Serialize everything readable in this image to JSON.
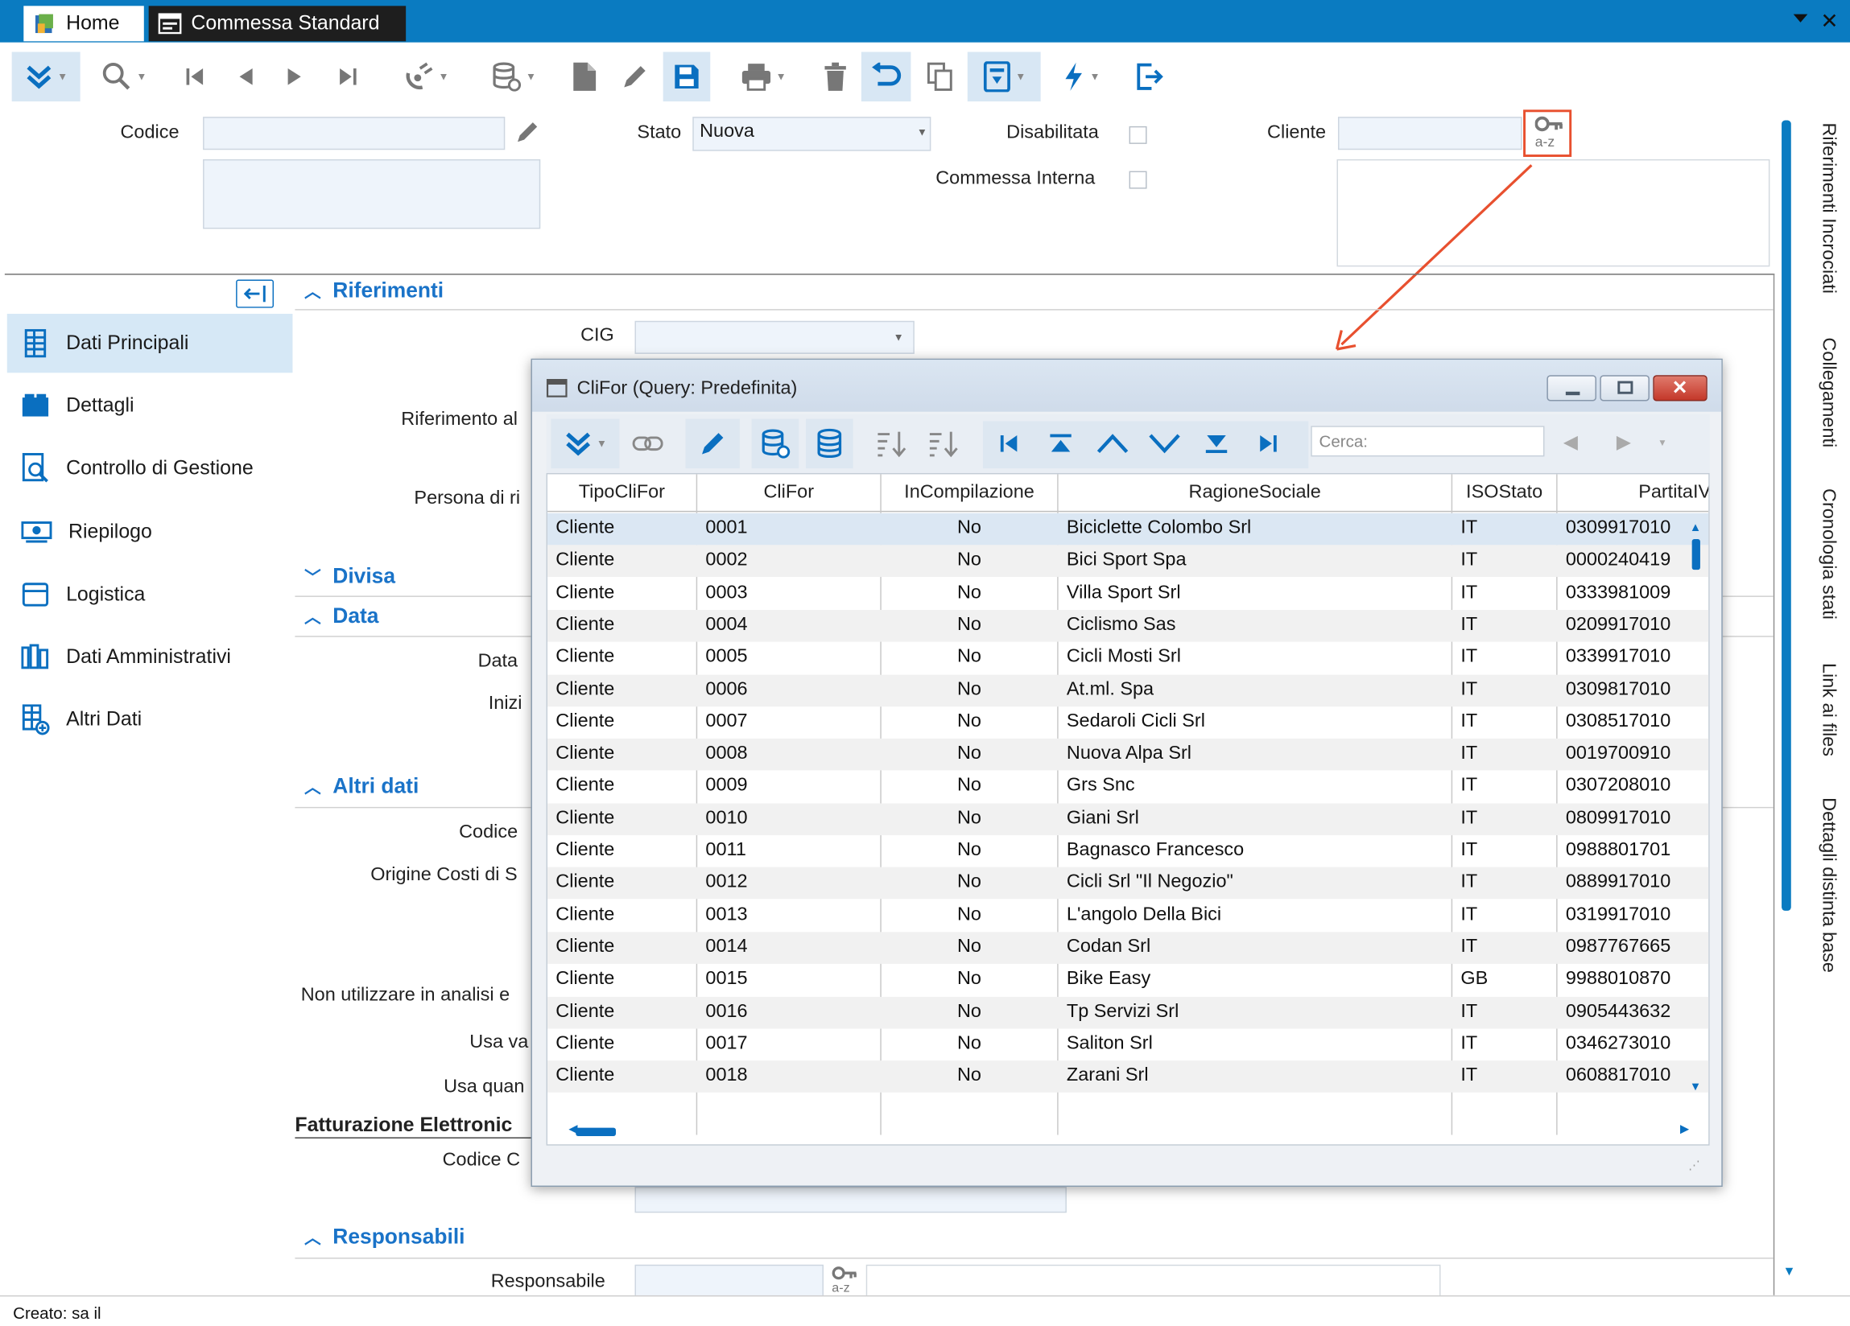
{
  "titlebar": {
    "home_label": "Home",
    "commessa_label": "Commessa Standard"
  },
  "toolbar": {
    "icons": [
      "double-chevron-down-icon",
      "search-icon",
      "first-icon",
      "prev-icon",
      "next-icon",
      "last-icon",
      "satellite-icon",
      "database-icon",
      "new-doc-icon",
      "edit-icon",
      "save-icon",
      "print-icon",
      "delete-icon",
      "undo-icon",
      "copy-icon",
      "report-icon",
      "flash-icon",
      "exit-icon"
    ]
  },
  "header": {
    "codice_label": "Codice",
    "codice_value": "",
    "stato_label": "Stato",
    "stato_value": "Nuova",
    "disabilitata_label": "Disabilitata",
    "commessa_interna_label": "Commessa Interna",
    "cliente_label": "Cliente",
    "cliente_value": "",
    "lookup_icon_text": "a-z"
  },
  "sidebar": {
    "items": [
      {
        "label": "Dati Principali"
      },
      {
        "label": "Dettagli"
      },
      {
        "label": "Controllo di Gestione"
      },
      {
        "label": "Riepilogo"
      },
      {
        "label": "Logistica"
      },
      {
        "label": "Dati Amministrativi"
      },
      {
        "label": "Altri Dati"
      }
    ]
  },
  "form": {
    "sections": {
      "riferimenti": "Riferimenti",
      "divisa": "Divisa",
      "data": "Data",
      "altri_dati": "Altri dati",
      "responsabili": "Responsabili"
    },
    "labels": {
      "cig": "CIG",
      "riferimento": "Riferimento al",
      "persona": "Persona di ri",
      "data_a": "Data",
      "inizio": "Inizi",
      "codice_b": "Codice",
      "origine": "Origine Costi di S",
      "non_utilizzare": "Non utilizzare in analisi e",
      "usa_va": "Usa va",
      "usa_quan": "Usa quan",
      "fatturazione": "Fatturazione Elettronic",
      "codice_c": "Codice C",
      "responsabile": "Responsabile"
    },
    "lookup_icon_text": "a-z"
  },
  "right_tabs": [
    "Riferimenti Incrociati",
    "Collegamenti",
    "Cronologia stati",
    "Link ai files",
    "Dettagli distinta base"
  ],
  "status": {
    "created": "Creato: sa il"
  },
  "modal": {
    "title": "CliFor (Query: Predefinita)",
    "search_placeholder": "Cerca:",
    "columns": [
      "TipoCliFor",
      "CliFor",
      "InCompilazione",
      "RagioneSociale",
      "ISOStato",
      "PartitaIV"
    ],
    "rows": [
      [
        "Cliente",
        "0001",
        "No",
        "Biciclette Colombo Srl",
        "IT",
        "0309917010"
      ],
      [
        "Cliente",
        "0002",
        "No",
        "Bici Sport Spa",
        "IT",
        "0000240419"
      ],
      [
        "Cliente",
        "0003",
        "No",
        "Villa Sport Srl",
        "IT",
        "0333981009"
      ],
      [
        "Cliente",
        "0004",
        "No",
        "Ciclismo Sas",
        "IT",
        "0209917010"
      ],
      [
        "Cliente",
        "0005",
        "No",
        "Cicli Mosti Srl",
        "IT",
        "0339917010"
      ],
      [
        "Cliente",
        "0006",
        "No",
        "At.ml. Spa",
        "IT",
        "0309817010"
      ],
      [
        "Cliente",
        "0007",
        "No",
        "Sedaroli Cicli Srl",
        "IT",
        "0308517010"
      ],
      [
        "Cliente",
        "0008",
        "No",
        "Nuova Alpa Srl",
        "IT",
        "0019700910"
      ],
      [
        "Cliente",
        "0009",
        "No",
        "Grs Snc",
        "IT",
        "0307208010"
      ],
      [
        "Cliente",
        "0010",
        "No",
        "Giani Srl",
        "IT",
        "0809917010"
      ],
      [
        "Cliente",
        "0011",
        "No",
        "Bagnasco Francesco",
        "IT",
        "0988801701"
      ],
      [
        "Cliente",
        "0012",
        "No",
        "Cicli Srl \"Il Negozio\"",
        "IT",
        "0889917010"
      ],
      [
        "Cliente",
        "0013",
        "No",
        "L'angolo Della Bici",
        "IT",
        "0319917010"
      ],
      [
        "Cliente",
        "0014",
        "No",
        "Codan Srl",
        "IT",
        "0987767665"
      ],
      [
        "Cliente",
        "0015",
        "No",
        "Bike Easy",
        "GB",
        "9988010870"
      ],
      [
        "Cliente",
        "0016",
        "No",
        "Tp Servizi Srl",
        "IT",
        "0905443632"
      ],
      [
        "Cliente",
        "0017",
        "No",
        "Saliton Srl",
        "IT",
        "0346273010"
      ],
      [
        "Cliente",
        "0018",
        "No",
        "Zarani Srl",
        "IT",
        "0608817010"
      ]
    ]
  },
  "colors": {
    "accent": "#0a7bc1",
    "section": "#1a73c8",
    "annotation": "#e8502f"
  }
}
